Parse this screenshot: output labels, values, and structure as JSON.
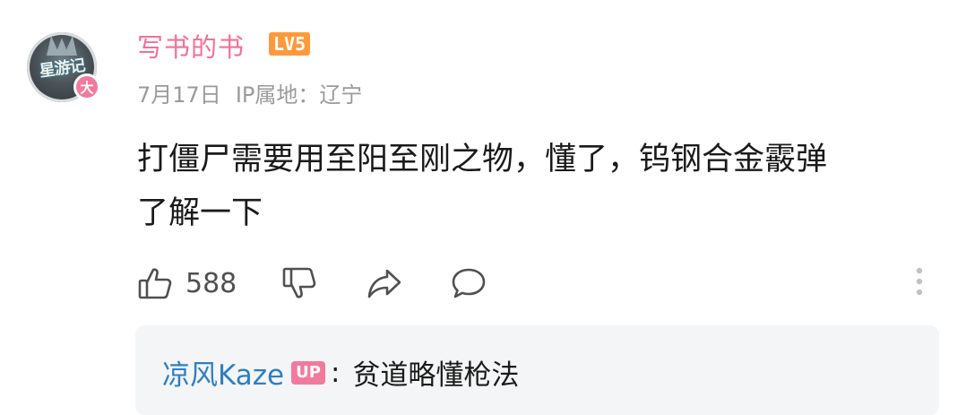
{
  "comment": {
    "username": "写书的书",
    "level_badge": "LV5",
    "avatar_badge": "大",
    "avatar_text": "星游记",
    "date": "7月17日",
    "location": "IP属地：辽宁",
    "text_line1": "打僵尸需要用至阳至刚之物，懂了，钨钢合金霰弹",
    "text_line2": "了解一下",
    "like_count": "588"
  },
  "reply": {
    "username": "凉风Kaze",
    "up_badge": "UP",
    "separator": ":",
    "text": "贫道略懂枪法"
  },
  "colors": {
    "username": "#f56f98",
    "level_badge": "#ff9a3c",
    "reply_username": "#2d7fc2",
    "up_badge": "#f27a9c",
    "meta": "#9a9a9a"
  },
  "icons": [
    "thumbs-up-icon",
    "thumbs-down-icon",
    "share-icon",
    "comment-icon",
    "more-icon"
  ]
}
